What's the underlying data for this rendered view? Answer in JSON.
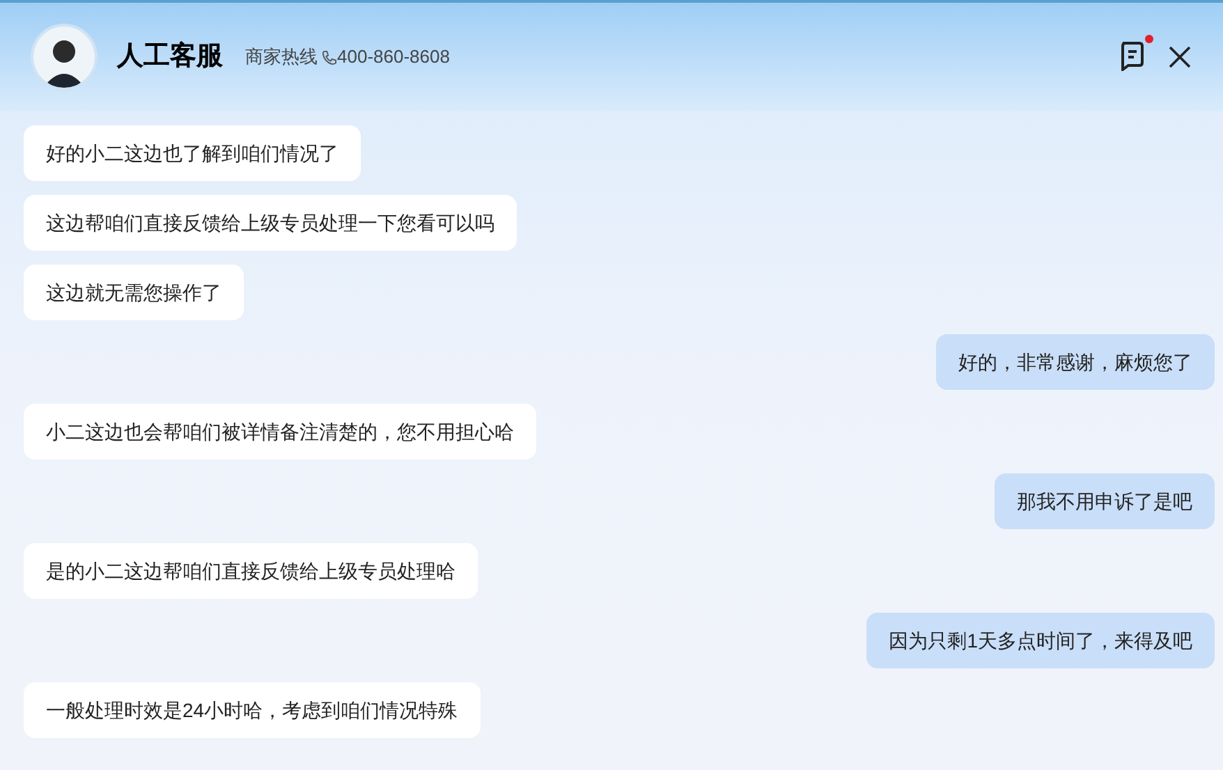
{
  "header": {
    "title": "人工客服",
    "hotline_label": "商家热线",
    "hotline_number": "400-860-8608",
    "notification": true
  },
  "messages": [
    {
      "kind": "received",
      "text": "好的小二这边也了解到咱们情况了"
    },
    {
      "kind": "received",
      "text": "这边帮咱们直接反馈给上级专员处理一下您看可以吗"
    },
    {
      "kind": "received",
      "text": "这边就无需您操作了"
    },
    {
      "kind": "sent",
      "text": "好的，非常感谢，麻烦您了"
    },
    {
      "kind": "received",
      "text": "小二这边也会帮咱们被详情备注清楚的，您不用担心哈"
    },
    {
      "kind": "sent",
      "text": "那我不用申诉了是吧"
    },
    {
      "kind": "received",
      "text": "是的小二这边帮咱们直接反馈给上级专员处理哈"
    },
    {
      "kind": "sent",
      "text": "因为只剩1天多点时间了，来得及吧"
    },
    {
      "kind": "received",
      "text": "一般处理时效是24小时哈，考虑到咱们情况特殊"
    }
  ]
}
